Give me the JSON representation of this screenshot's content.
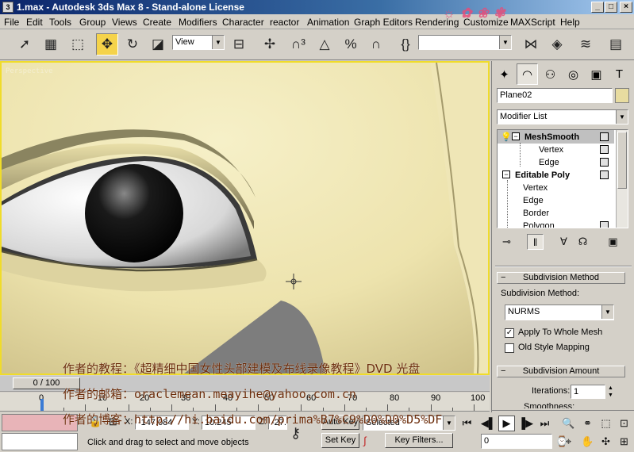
{
  "window": {
    "title": "1.max - Autodesk 3ds Max 8 - Stand-alone License",
    "controls": [
      "_",
      "□",
      "×"
    ]
  },
  "menu": [
    "File",
    "Edit",
    "Tools",
    "Group",
    "Views",
    "Create",
    "Modifiers",
    "Character",
    "reactor",
    "Animation",
    "Graph Editors",
    "Rendering",
    "Customize",
    "MAXScript",
    "Help"
  ],
  "toolbar": {
    "ref_coord": "View",
    "named_selection": ""
  },
  "viewport": {
    "label": "Perspective"
  },
  "timeline": {
    "slider_text": "0 / 100",
    "ticks": [
      "0",
      "10",
      "20",
      "30",
      "40",
      "50",
      "60",
      "70",
      "80",
      "90",
      "100"
    ]
  },
  "status": {
    "prompt": "Click and drag to select and move objects",
    "x_label": "X:",
    "x_value": "-147.084",
    "y_label": "Y:",
    "y_value": "10.245",
    "z_label": "Z:",
    "z_value": "-27.",
    "auto_key": "Auto Key",
    "set_key": "Set Key",
    "key_mode": "Selected",
    "key_filters": "Key Filters...",
    "frame": "0"
  },
  "command_panel": {
    "object_name": "Plane02",
    "object_color": "#e8dca0",
    "modifier_list": "Modifier List",
    "stack": [
      {
        "label": "MeshSmooth",
        "level": 0,
        "bold": true,
        "selected": true
      },
      {
        "label": "Vertex",
        "level": 2,
        "bold": false,
        "selected": false
      },
      {
        "label": "Edge",
        "level": 2,
        "bold": false,
        "selected": false
      },
      {
        "label": "Editable Poly",
        "level": 0,
        "bold": true,
        "selected": false
      },
      {
        "label": "Vertex",
        "level": 1,
        "bold": false,
        "selected": false
      },
      {
        "label": "Edge",
        "level": 1,
        "bold": false,
        "selected": false
      },
      {
        "label": "Border",
        "level": 1,
        "bold": false,
        "selected": false
      },
      {
        "label": "Polygon",
        "level": 1,
        "bold": false,
        "selected": false
      }
    ],
    "rollout_subdivision": {
      "title": "Subdivision Method",
      "method_label": "Subdivision Method:",
      "method_value": "NURMS",
      "apply_whole_mesh": "Apply To Whole Mesh",
      "apply_checked": true,
      "old_style": "Old Style Mapping",
      "old_checked": false
    },
    "rollout_amount": {
      "title": "Subdivision Amount",
      "iterations_label": "Iterations:",
      "iterations_value": "1",
      "smoothness_label": "Smoothness:"
    }
  },
  "overlay": {
    "line1": "作者的教程：《超精细中国女性头部建模及布线录像教程》DVD 光盘",
    "line2": "作者的邮箱：oraclemean.meayihe@yahoo.com.cn",
    "line3": "作者的博客：http://hi.baidu.com/prima%B7%C9%D0%D0%D5%DF"
  }
}
